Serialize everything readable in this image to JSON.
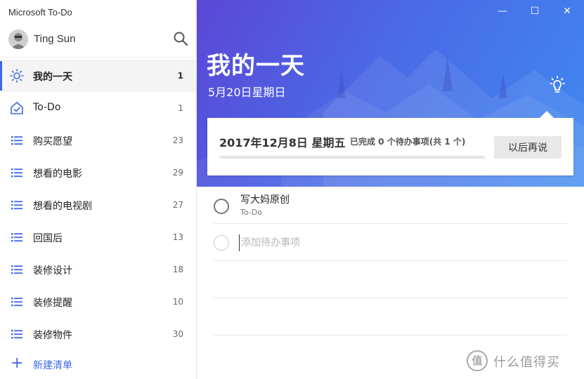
{
  "app": {
    "title": "Microsoft To-Do"
  },
  "user": {
    "name": "Ting Sun"
  },
  "sidebar": {
    "items": [
      {
        "label": "我的一天",
        "count": "1",
        "icon": "sun-icon"
      },
      {
        "label": "To-Do",
        "count": "1",
        "icon": "home-icon"
      },
      {
        "label": "购买愿望",
        "count": "23",
        "icon": "list-icon"
      },
      {
        "label": "想看的电影",
        "count": "29",
        "icon": "list-icon"
      },
      {
        "label": "想看的电视剧",
        "count": "27",
        "icon": "list-icon"
      },
      {
        "label": "回国后",
        "count": "13",
        "icon": "list-icon"
      },
      {
        "label": "装修设计",
        "count": "18",
        "icon": "list-icon"
      },
      {
        "label": "装修提醒",
        "count": "10",
        "icon": "list-icon"
      },
      {
        "label": "装修物件",
        "count": "30",
        "icon": "list-icon"
      }
    ],
    "new_list": {
      "plus": "+",
      "label": "新建清单"
    }
  },
  "window": {
    "minimize": "—",
    "maximize": "☐",
    "close": "✕"
  },
  "main": {
    "title": "我的一天",
    "date": "5月20日星期日",
    "suggestion": {
      "date": "2017年12月8日 星期五",
      "status": "已完成 0 个待办事项(共 1 个)",
      "progress": 0,
      "later_label": "以后再说"
    },
    "tasks": [
      {
        "title": "写大妈原创",
        "list": "To-Do"
      }
    ],
    "add_placeholder": "添加待办事项"
  },
  "watermark": {
    "icon": "值",
    "text": "什么值得买"
  },
  "colors": {
    "accent": "#3e69e4",
    "hero_start": "#5b47d6",
    "hero_end": "#3f8af0"
  }
}
